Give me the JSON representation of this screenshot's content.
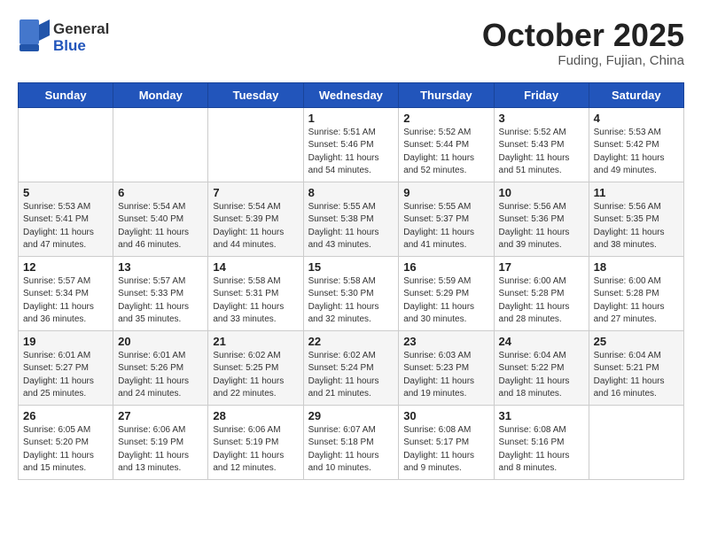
{
  "header": {
    "logo_line1": "General",
    "logo_line2": "Blue",
    "month": "October 2025",
    "location": "Fuding, Fujian, China"
  },
  "weekdays": [
    "Sunday",
    "Monday",
    "Tuesday",
    "Wednesday",
    "Thursday",
    "Friday",
    "Saturday"
  ],
  "rows": [
    [
      {
        "day": "",
        "info": ""
      },
      {
        "day": "",
        "info": ""
      },
      {
        "day": "",
        "info": ""
      },
      {
        "day": "1",
        "info": "Sunrise: 5:51 AM\nSunset: 5:46 PM\nDaylight: 11 hours\nand 54 minutes."
      },
      {
        "day": "2",
        "info": "Sunrise: 5:52 AM\nSunset: 5:44 PM\nDaylight: 11 hours\nand 52 minutes."
      },
      {
        "day": "3",
        "info": "Sunrise: 5:52 AM\nSunset: 5:43 PM\nDaylight: 11 hours\nand 51 minutes."
      },
      {
        "day": "4",
        "info": "Sunrise: 5:53 AM\nSunset: 5:42 PM\nDaylight: 11 hours\nand 49 minutes."
      }
    ],
    [
      {
        "day": "5",
        "info": "Sunrise: 5:53 AM\nSunset: 5:41 PM\nDaylight: 11 hours\nand 47 minutes."
      },
      {
        "day": "6",
        "info": "Sunrise: 5:54 AM\nSunset: 5:40 PM\nDaylight: 11 hours\nand 46 minutes."
      },
      {
        "day": "7",
        "info": "Sunrise: 5:54 AM\nSunset: 5:39 PM\nDaylight: 11 hours\nand 44 minutes."
      },
      {
        "day": "8",
        "info": "Sunrise: 5:55 AM\nSunset: 5:38 PM\nDaylight: 11 hours\nand 43 minutes."
      },
      {
        "day": "9",
        "info": "Sunrise: 5:55 AM\nSunset: 5:37 PM\nDaylight: 11 hours\nand 41 minutes."
      },
      {
        "day": "10",
        "info": "Sunrise: 5:56 AM\nSunset: 5:36 PM\nDaylight: 11 hours\nand 39 minutes."
      },
      {
        "day": "11",
        "info": "Sunrise: 5:56 AM\nSunset: 5:35 PM\nDaylight: 11 hours\nand 38 minutes."
      }
    ],
    [
      {
        "day": "12",
        "info": "Sunrise: 5:57 AM\nSunset: 5:34 PM\nDaylight: 11 hours\nand 36 minutes."
      },
      {
        "day": "13",
        "info": "Sunrise: 5:57 AM\nSunset: 5:33 PM\nDaylight: 11 hours\nand 35 minutes."
      },
      {
        "day": "14",
        "info": "Sunrise: 5:58 AM\nSunset: 5:31 PM\nDaylight: 11 hours\nand 33 minutes."
      },
      {
        "day": "15",
        "info": "Sunrise: 5:58 AM\nSunset: 5:30 PM\nDaylight: 11 hours\nand 32 minutes."
      },
      {
        "day": "16",
        "info": "Sunrise: 5:59 AM\nSunset: 5:29 PM\nDaylight: 11 hours\nand 30 minutes."
      },
      {
        "day": "17",
        "info": "Sunrise: 6:00 AM\nSunset: 5:28 PM\nDaylight: 11 hours\nand 28 minutes."
      },
      {
        "day": "18",
        "info": "Sunrise: 6:00 AM\nSunset: 5:28 PM\nDaylight: 11 hours\nand 27 minutes."
      }
    ],
    [
      {
        "day": "19",
        "info": "Sunrise: 6:01 AM\nSunset: 5:27 PM\nDaylight: 11 hours\nand 25 minutes."
      },
      {
        "day": "20",
        "info": "Sunrise: 6:01 AM\nSunset: 5:26 PM\nDaylight: 11 hours\nand 24 minutes."
      },
      {
        "day": "21",
        "info": "Sunrise: 6:02 AM\nSunset: 5:25 PM\nDaylight: 11 hours\nand 22 minutes."
      },
      {
        "day": "22",
        "info": "Sunrise: 6:02 AM\nSunset: 5:24 PM\nDaylight: 11 hours\nand 21 minutes."
      },
      {
        "day": "23",
        "info": "Sunrise: 6:03 AM\nSunset: 5:23 PM\nDaylight: 11 hours\nand 19 minutes."
      },
      {
        "day": "24",
        "info": "Sunrise: 6:04 AM\nSunset: 5:22 PM\nDaylight: 11 hours\nand 18 minutes."
      },
      {
        "day": "25",
        "info": "Sunrise: 6:04 AM\nSunset: 5:21 PM\nDaylight: 11 hours\nand 16 minutes."
      }
    ],
    [
      {
        "day": "26",
        "info": "Sunrise: 6:05 AM\nSunset: 5:20 PM\nDaylight: 11 hours\nand 15 minutes."
      },
      {
        "day": "27",
        "info": "Sunrise: 6:06 AM\nSunset: 5:19 PM\nDaylight: 11 hours\nand 13 minutes."
      },
      {
        "day": "28",
        "info": "Sunrise: 6:06 AM\nSunset: 5:19 PM\nDaylight: 11 hours\nand 12 minutes."
      },
      {
        "day": "29",
        "info": "Sunrise: 6:07 AM\nSunset: 5:18 PM\nDaylight: 11 hours\nand 10 minutes."
      },
      {
        "day": "30",
        "info": "Sunrise: 6:08 AM\nSunset: 5:17 PM\nDaylight: 11 hours\nand 9 minutes."
      },
      {
        "day": "31",
        "info": "Sunrise: 6:08 AM\nSunset: 5:16 PM\nDaylight: 11 hours\nand 8 minutes."
      },
      {
        "day": "",
        "info": ""
      }
    ]
  ]
}
